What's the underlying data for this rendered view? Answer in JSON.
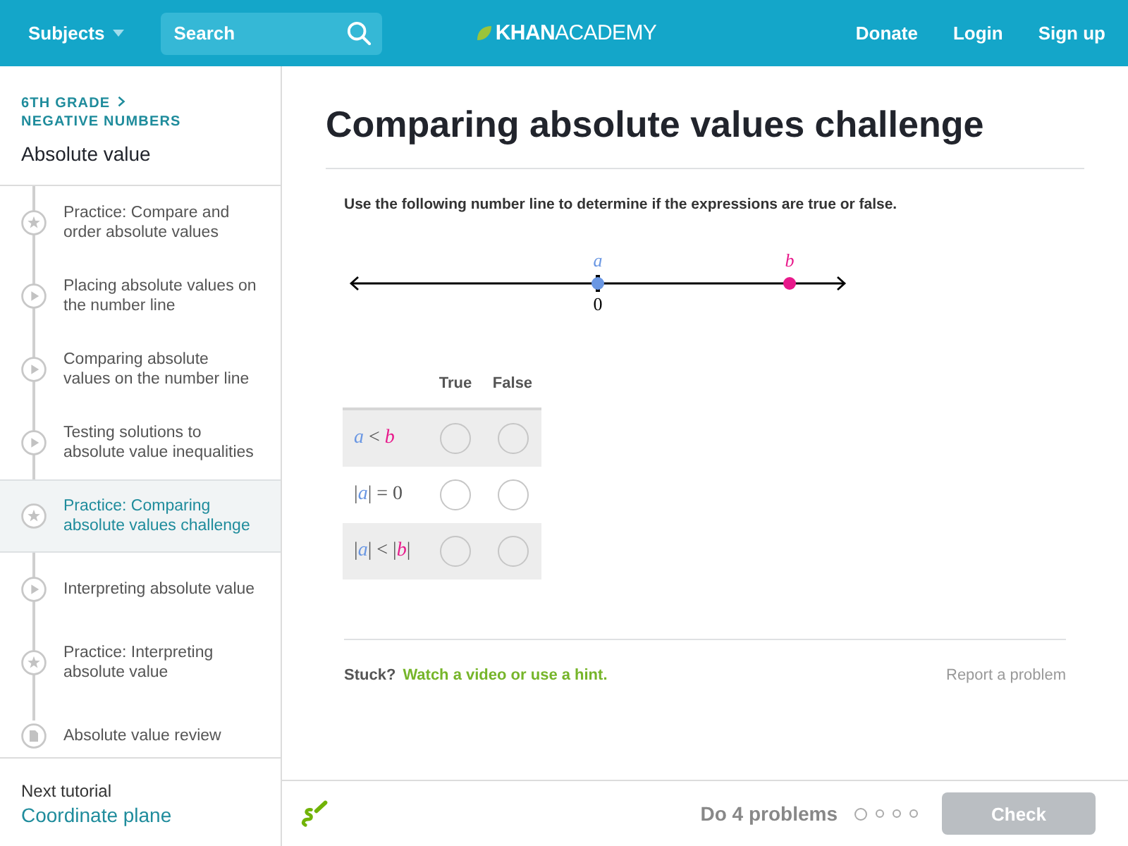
{
  "top_bar": {
    "subjects": "Subjects",
    "search": {
      "placeholder": "Search"
    },
    "logo": "**KHAN**ACADEMY",
    "links": [
      "Donate",
      "Login",
      "Sign up"
    ]
  },
  "sidebar": {
    "breadcrumb": [
      "6TH GRADE",
      "NEGATIVE NUMBERS"
    ],
    "title": "Absolute value",
    "items": [
      {
        "kind": "practice",
        "label": "Practice: Compare and order absolute values",
        "selected": false
      },
      {
        "kind": "video",
        "label": "Placing absolute values on the number line",
        "selected": false
      },
      {
        "kind": "video",
        "label": "Comparing absolute values on the number line",
        "selected": false
      },
      {
        "kind": "video",
        "label": "Testing solutions to absolute value inequalities",
        "selected": false
      },
      {
        "kind": "practice",
        "label": "Practice: Comparing absolute values challenge",
        "selected": true
      },
      {
        "kind": "video",
        "label": "Interpreting absolute value",
        "selected": false
      },
      {
        "kind": "practice",
        "label": "Practice: Interpreting absolute value",
        "selected": false
      },
      {
        "kind": "article",
        "label": "Absolute value review",
        "selected": false
      }
    ],
    "next_label": "Next tutorial",
    "next_link": "Coordinate plane"
  },
  "exercise": {
    "title": "Comparing absolute values challenge",
    "instruction": "Use the following number line to determine if the expressions are true or false.",
    "number_line": {
      "zero_label": "0",
      "points": [
        {
          "label": "a",
          "color": "#6a97e3"
        },
        {
          "label": "b",
          "color": "#e8198b"
        }
      ]
    },
    "table": {
      "columns": [
        "True",
        "False"
      ],
      "rows": [
        {
          "expression": [
            {
              "kind": "var",
              "text": "a",
              "color": "#6a97e3"
            },
            {
              "kind": "op",
              "text": " < "
            },
            {
              "kind": "var",
              "text": "b",
              "color": "#e8198b"
            }
          ],
          "choices": [
            {
              "selected": false
            },
            {
              "selected": false
            }
          ]
        },
        {
          "expression": [
            {
              "kind": "op",
              "text": "|"
            },
            {
              "kind": "var",
              "text": "a",
              "color": "#6a97e3"
            },
            {
              "kind": "op",
              "text": "| = 0"
            }
          ],
          "choices": [
            {
              "selected": false
            },
            {
              "selected": false
            }
          ]
        },
        {
          "expression": [
            {
              "kind": "op",
              "text": "|"
            },
            {
              "kind": "var",
              "text": "a",
              "color": "#6a97e3"
            },
            {
              "kind": "op",
              "text": "| < |"
            },
            {
              "kind": "var",
              "text": "b",
              "color": "#e8198b"
            },
            {
              "kind": "op",
              "text": "|"
            }
          ],
          "choices": [
            {
              "selected": false
            },
            {
              "selected": false
            }
          ]
        }
      ]
    },
    "stuck": "Stuck?",
    "help_link": "Watch a video or use a hint.",
    "report": "Report a problem"
  },
  "bottom_bar": {
    "goal": "Do 4 problems",
    "progress": [
      {
        "current": true
      },
      {
        "current": false
      },
      {
        "current": false
      },
      {
        "current": false
      }
    ],
    "check": {
      "label": "Check",
      "disabled": true
    }
  }
}
